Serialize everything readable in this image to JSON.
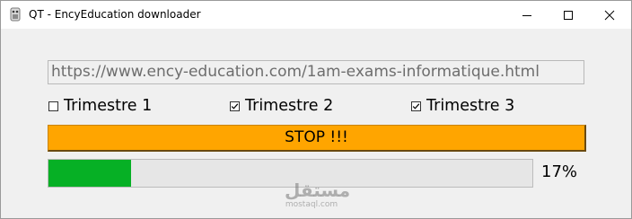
{
  "window": {
    "title": "QT - EncyEducation downloader",
    "icon": "qt-app-icon",
    "controls": [
      "minimize-icon",
      "maximize-icon",
      "close-icon"
    ]
  },
  "url_field": {
    "value": "https://www.ency-education.com/1am-exams-informatique.html"
  },
  "checkboxes": [
    {
      "label": "Trimestre 1",
      "checked": false
    },
    {
      "label": "Trimestre 2",
      "checked": true
    },
    {
      "label": "Trimestre 3",
      "checked": true
    }
  ],
  "stop_button": {
    "label": "STOP !!!",
    "color": "#ffa500"
  },
  "progress": {
    "value": 0.17,
    "label": "17%",
    "fill_color": "#06b025"
  },
  "watermark": {
    "arabic": "مستقل",
    "latin": "mostaql.com"
  }
}
